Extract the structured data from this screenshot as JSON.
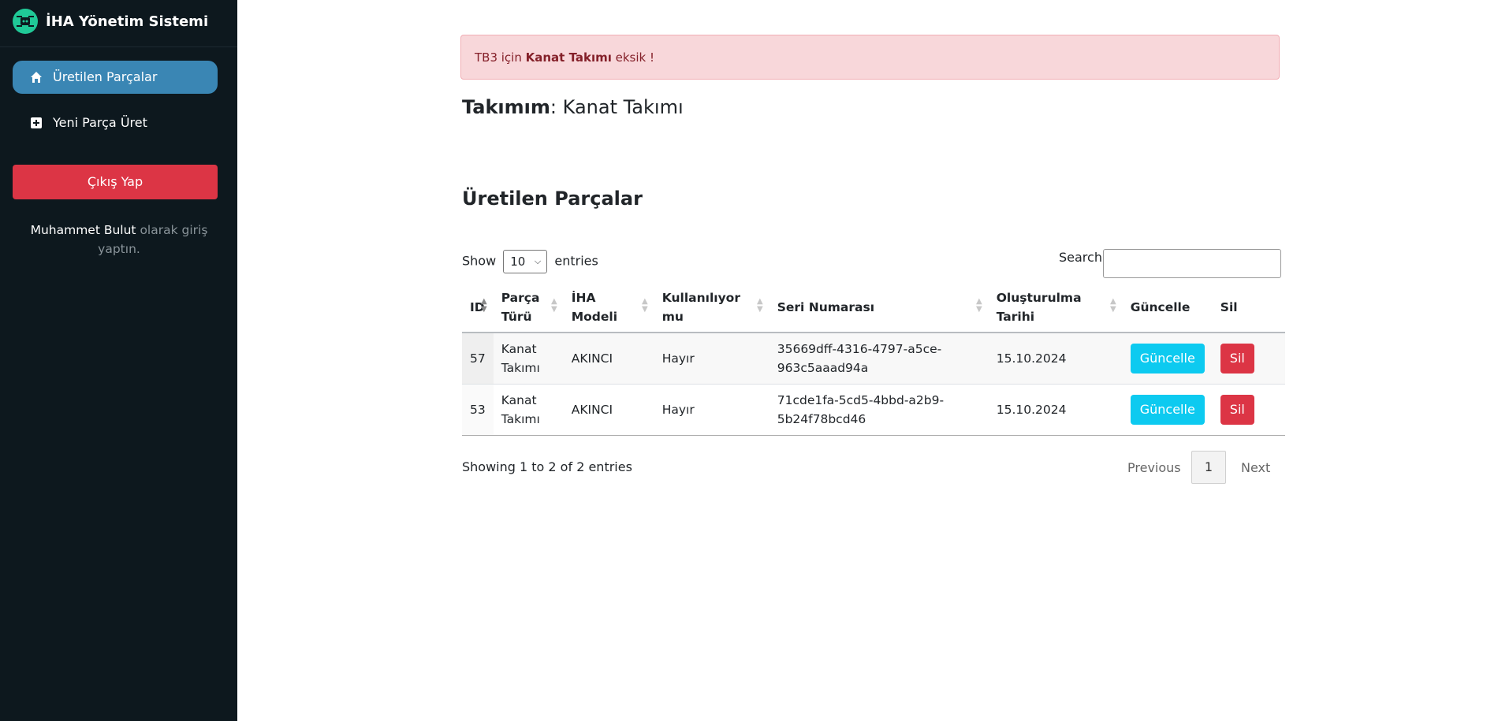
{
  "app": {
    "title": "İHA Yönetim Sistemi",
    "logo_icon": "drone-icon"
  },
  "sidebar": {
    "items": [
      {
        "label": "Üretilen Parçalar",
        "icon": "home-icon",
        "active": true
      },
      {
        "label": "Yeni Parça Üret",
        "icon": "plus-square-icon",
        "active": false
      }
    ],
    "logout_label": "Çıkış Yap",
    "user": {
      "name": "Muhammet Bulut",
      "suffix": " olarak giriş yaptın."
    }
  },
  "alert": {
    "prefix": "TB3 için ",
    "bold": "Kanat Takımı",
    "suffix": " eksik !"
  },
  "team": {
    "label": "Takımım",
    "value": ": Kanat Takımı"
  },
  "section_title": "Üretilen Parçalar",
  "table_controls": {
    "show_label": "Show",
    "length_value": "10",
    "entries_label": "entries",
    "search_label": "Search:",
    "search_value": ""
  },
  "table": {
    "columns": [
      "ID",
      "Parça Türü",
      "İHA Modeli",
      "Kullanılıyor mu",
      "Seri Numarası",
      "Oluşturulma Tarihi",
      "Güncelle",
      "Sil"
    ],
    "rows": [
      {
        "id": "57",
        "type": "Kanat Takımı",
        "model": "AKINCI",
        "in_use": "Hayır",
        "serial": "35669dff-4316-4797-a5ce-963c5aaad94a",
        "date": "15.10.2024",
        "update_label": "Güncelle",
        "delete_label": "Sil"
      },
      {
        "id": "53",
        "type": "Kanat Takımı",
        "model": "AKINCI",
        "in_use": "Hayır",
        "serial": "71cde1fa-5cd5-4bbd-a2b9-5b24f78bcd46",
        "date": "15.10.2024",
        "update_label": "Güncelle",
        "delete_label": "Sil"
      }
    ]
  },
  "footer": {
    "info": "Showing 1 to 2 of 2 entries",
    "previous": "Previous",
    "page": "1",
    "next": "Next"
  },
  "colors": {
    "sidebar_bg": "#0d181e",
    "active_nav": "#3a86b4",
    "danger": "#dc3545",
    "info": "#0dcaf0",
    "alert_bg": "#f8d7da",
    "logo": "#20c997"
  }
}
